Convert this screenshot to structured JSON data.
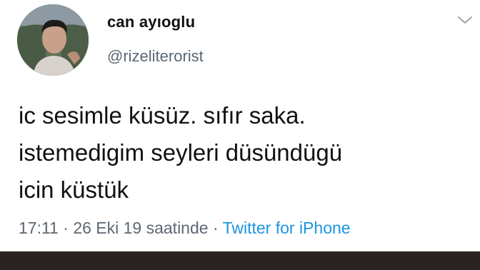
{
  "tweet": {
    "display_name": "can ayıoglu",
    "handle": "@rizeliterorist",
    "text_lines": [
      "ic sesimle küsüz. sıfır saka.",
      "istemedigim seyleri düsündügü",
      "icin küstük"
    ],
    "time": "17:11",
    "separator": " · ",
    "date": "26 Eki 19 saatinde",
    "source": "Twitter for iPhone"
  },
  "icons": {
    "avatar": "profile-photo",
    "menu": "chevron-down-icon"
  },
  "colors": {
    "text": "#111111",
    "secondary": "#5b6773",
    "link": "#1b95e0",
    "bottom_bar": "#2b2322"
  }
}
